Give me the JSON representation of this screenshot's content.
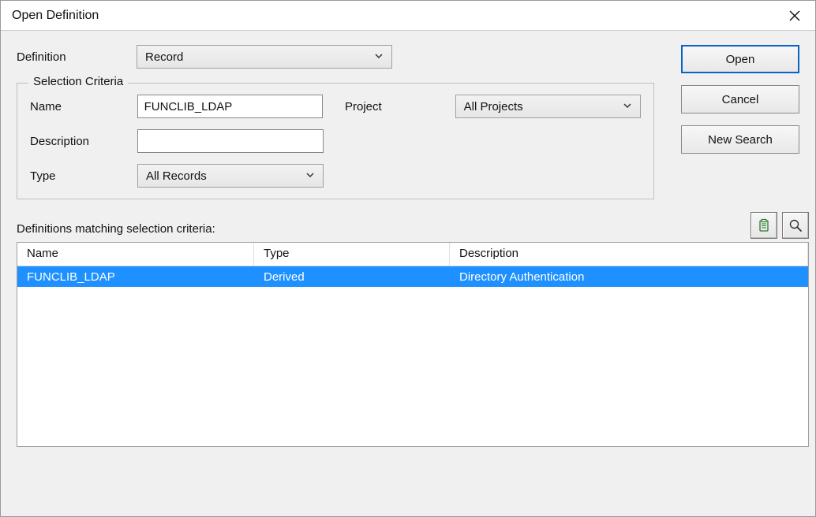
{
  "dialog": {
    "title": "Open Definition"
  },
  "definition": {
    "label": "Definition",
    "value": "Record"
  },
  "criteria": {
    "legend": "Selection Criteria",
    "name_label": "Name",
    "name_value": "FUNCLIB_LDAP",
    "description_label": "Description",
    "description_value": "",
    "type_label": "Type",
    "type_value": "All Records",
    "project_label": "Project",
    "project_value": "All Projects"
  },
  "buttons": {
    "open_label": "Open",
    "cancel_label": "Cancel",
    "new_search_label": "New Search"
  },
  "results": {
    "caption": "Definitions matching selection criteria:",
    "columns": {
      "name": "Name",
      "type": "Type",
      "description": "Description"
    },
    "rows": [
      {
        "name": "FUNCLIB_LDAP",
        "type": "Derived",
        "description": "Directory Authentication"
      }
    ]
  },
  "icons": {
    "clipboard": "clipboard-icon",
    "magnifier": "magnifier-icon",
    "close": "close-icon",
    "chevron": "chevron-down-icon"
  }
}
